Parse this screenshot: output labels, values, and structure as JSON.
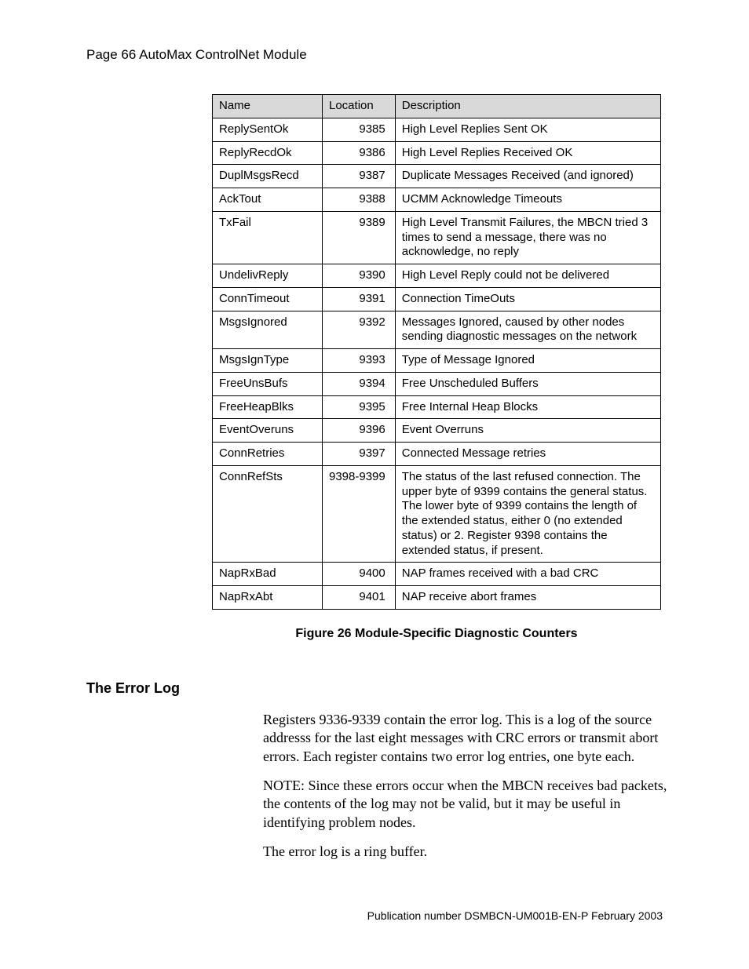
{
  "header": {
    "page_line": "Page 66  AutoMax ControlNet Module"
  },
  "table": {
    "columns": {
      "c0": "Name",
      "c1": "Location",
      "c2": "Description"
    },
    "rows": [
      {
        "name": "ReplySentOk",
        "loc": "9385",
        "desc": "High Level Replies Sent OK"
      },
      {
        "name": "ReplyRecdOk",
        "loc": "9386",
        "desc": "High Level Replies Received OK"
      },
      {
        "name": "DuplMsgsRecd",
        "loc": "9387",
        "desc": "Duplicate Messages Received (and ignored)"
      },
      {
        "name": "AckTout",
        "loc": "9388",
        "desc": "UCMM Acknowledge Timeouts"
      },
      {
        "name": "TxFail",
        "loc": "9389",
        "desc": "High Level Transmit Failures, the MBCN tried 3 times to send a message, there was no acknowledge, no reply"
      },
      {
        "name": "UndelivReply",
        "loc": "9390",
        "desc": "High Level Reply could not be delivered"
      },
      {
        "name": "ConnTimeout",
        "loc": "9391",
        "desc": "Connection TimeOuts"
      },
      {
        "name": "MsgsIgnored",
        "loc": "9392",
        "desc": "Messages Ignored, caused by other nodes sending diagnostic messages on the network"
      },
      {
        "name": "MsgsIgnType",
        "loc": "9393",
        "desc": "Type of Message Ignored"
      },
      {
        "name": "FreeUnsBufs",
        "loc": "9394",
        "desc": "Free Unscheduled Buffers"
      },
      {
        "name": "FreeHeapBlks",
        "loc": "9395",
        "desc": "Free Internal Heap Blocks"
      },
      {
        "name": "EventOveruns",
        "loc": "9396",
        "desc": "Event Overruns"
      },
      {
        "name": "ConnRetries",
        "loc": "9397",
        "desc": "Connected Message retries"
      },
      {
        "name": "ConnRefSts",
        "loc": "9398-9399",
        "desc": "The status of the last refused connection.  The upper byte of 9399 contains the general status.  The lower byte of 9399 contains the length of the extended status, either 0 (no extended status) or 2.  Register 9398 contains the extended status, if present."
      },
      {
        "name": "NapRxBad",
        "loc": "9400",
        "desc": "NAP frames received with a bad CRC"
      },
      {
        "name": "NapRxAbt",
        "loc": "9401",
        "desc": "NAP receive abort frames"
      }
    ]
  },
  "figure_caption": "Figure 26 Module-Specific Diagnostic Counters",
  "section": {
    "heading": "The Error Log",
    "p1": "Registers 9336-9339 contain the error log.  This is a log of the source addresss for the last eight messages with CRC errors or transmit abort errors.  Each register contains two error log entries, one byte each.",
    "p2": "NOTE: Since these errors occur when the MBCN receives bad packets, the contents of the log may not be valid, but it may be useful in identifying problem nodes.",
    "p3": "The error log is a ring buffer."
  },
  "footer": "Publication number DSMBCN-UM001B-EN-P February 2003"
}
